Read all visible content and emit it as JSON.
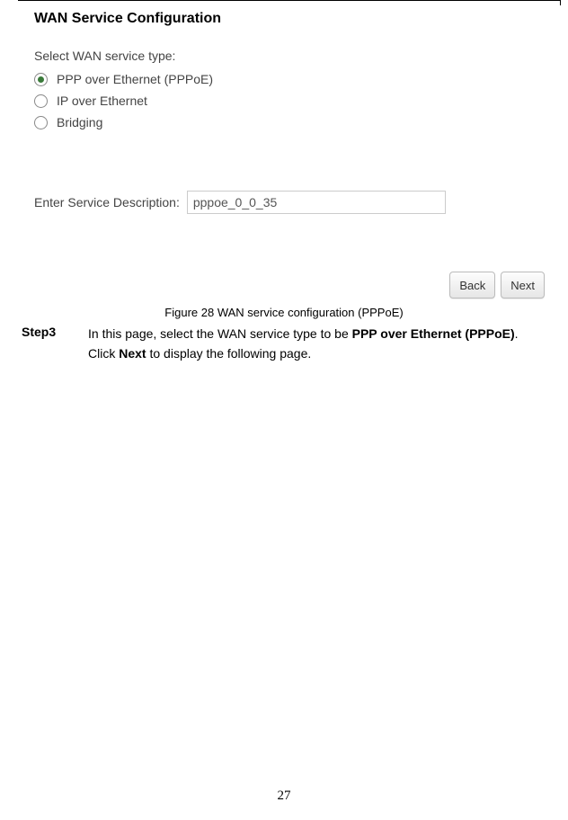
{
  "config": {
    "title": "WAN Service Configuration",
    "select_label": "Select WAN service type:",
    "options": {
      "pppoe": "PPP over Ethernet (PPPoE)",
      "ipoe": "IP over Ethernet",
      "bridging": "Bridging"
    },
    "desc_label": "Enter Service Description:",
    "desc_value": "pppoe_0_0_35",
    "back_label": "Back",
    "next_label": "Next"
  },
  "caption": "Figure 28 WAN service configuration (PPPoE)",
  "step": {
    "label": "Step3",
    "pre": "In this page, select the WAN service type to be ",
    "b1": "PPP over Ethernet (PPPoE)",
    "mid": ". Click ",
    "b2": "Next",
    "post": " to display the following page."
  },
  "page_number": "27"
}
